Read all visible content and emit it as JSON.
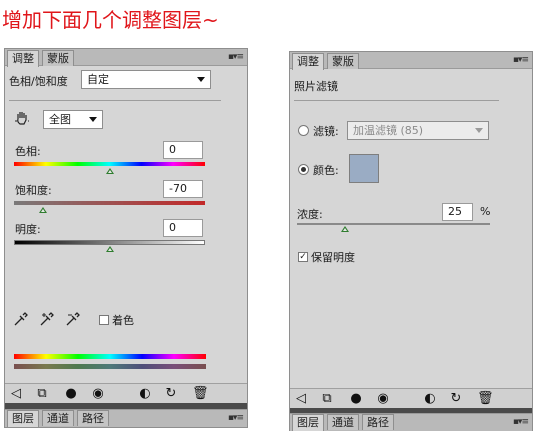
{
  "headline": "增加下面几个调整图层~",
  "left_panel": {
    "tabs": [
      "调整",
      "蒙版"
    ],
    "preset_label": "色相/饱和度",
    "preset_value": "自定",
    "channel_value": "全图",
    "hue": {
      "label": "色相:",
      "value": "0"
    },
    "saturation": {
      "label": "饱和度:",
      "value": "-70"
    },
    "lightness": {
      "label": "明度:",
      "value": "0"
    },
    "colorize_label": "着色",
    "colorize_checked": false,
    "bottom_tabs": [
      "图层",
      "通道",
      "路径"
    ]
  },
  "right_panel": {
    "tabs": [
      "调整",
      "蒙版"
    ],
    "title": "照片滤镜",
    "filter_label": "滤镜:",
    "filter_value": "加温滤镜 (85)",
    "color_label": "颜色:",
    "color_swatch": "#9aacc4",
    "density_label": "浓度:",
    "density_value": "25",
    "density_unit": "%",
    "preserve_label": "保留明度",
    "preserve_checked": true,
    "bottom_tabs": [
      "图层",
      "通道",
      "路径"
    ]
  },
  "colors": {
    "headline": "#e0151a",
    "panel_bg": "#d6d6d6",
    "tab_bar": "#b9b9b9"
  }
}
